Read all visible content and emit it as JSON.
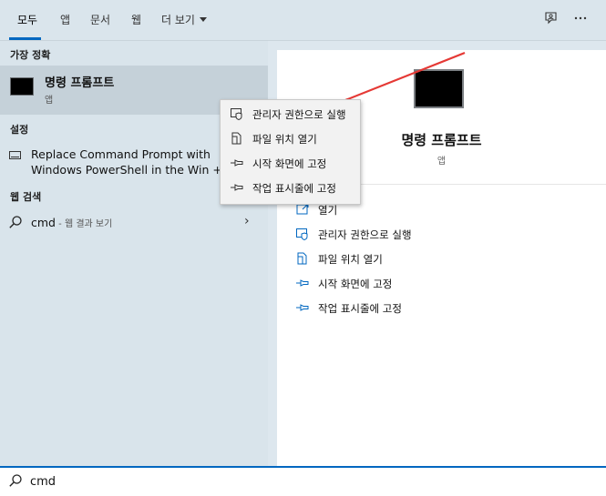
{
  "tabs": [
    {
      "label": "모두"
    },
    {
      "label": "앱"
    },
    {
      "label": "문서"
    },
    {
      "label": "웹"
    },
    {
      "label": "더 보기"
    }
  ],
  "sections": {
    "best_match": "가장 정확",
    "settings": "설정",
    "web_search": "웹 검색"
  },
  "best_match": {
    "name": "명령 프롬프트",
    "type": "앱"
  },
  "settings_item": {
    "line1": "Replace Command Prompt with",
    "line2": "Windows PowerShell in the Win +"
  },
  "web_item": {
    "query": "cmd",
    "suffix": " - 웹 결과 보기"
  },
  "context_menu": [
    {
      "label": "관리자 권한으로 실행",
      "icon": "shield-icon"
    },
    {
      "label": "파일 위치 열기",
      "icon": "file-location-icon"
    },
    {
      "label": "시작 화면에 고정",
      "icon": "pin-icon"
    },
    {
      "label": "작업 표시줄에 고정",
      "icon": "pin-icon"
    }
  ],
  "details": {
    "title": "명령 프롬프트",
    "subtitle": "앱",
    "actions": [
      {
        "label": "열기",
        "icon": "open-icon"
      },
      {
        "label": "관리자 권한으로 실행",
        "icon": "shield-icon"
      },
      {
        "label": "파일 위치 열기",
        "icon": "file-location-icon"
      },
      {
        "label": "시작 화면에 고정",
        "icon": "pin-icon"
      },
      {
        "label": "작업 표시줄에 고정",
        "icon": "pin-icon"
      }
    ]
  },
  "search": {
    "value": "cmd"
  },
  "colors": {
    "accent": "#0067c0",
    "arrow": "#e53935"
  }
}
